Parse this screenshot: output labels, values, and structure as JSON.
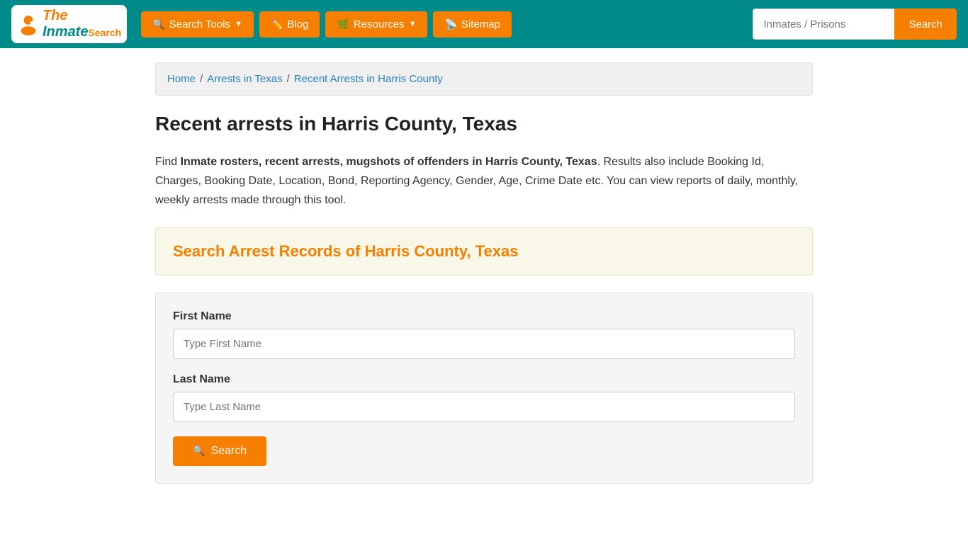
{
  "brand": {
    "name": "The InmateSearch",
    "logo_text_1": "The",
    "logo_text_2": "Inmate",
    "logo_text_3": "Search"
  },
  "navbar": {
    "search_tools_label": "Search Tools",
    "blog_label": "Blog",
    "resources_label": "Resources",
    "sitemap_label": "Sitemap",
    "search_input_placeholder": "Inmates / Prisons",
    "search_button_label": "Search"
  },
  "breadcrumb": {
    "home_label": "Home",
    "sep1": "/",
    "arrests_texas_label": "Arrests in Texas",
    "sep2": "/",
    "current_label": "Recent Arrests in Harris County"
  },
  "page": {
    "title": "Recent arrests in Harris County, Texas",
    "description_1": "Find ",
    "description_bold": "Inmate rosters, recent arrests, mugshots of offenders in Harris County, Texas",
    "description_2": ". Results also include Booking Id, Charges, Booking Date, Location, Bond, Reporting Agency, Gender, Age, Crime Date etc. You can view reports of daily, monthly, weekly arrests made through this tool.",
    "search_section_title": "Search Arrest Records of Harris County, Texas"
  },
  "form": {
    "first_name_label": "First Name",
    "first_name_placeholder": "Type First Name",
    "last_name_label": "Last Name",
    "last_name_placeholder": "Type Last Name",
    "search_button_label": "Search"
  },
  "colors": {
    "teal": "#008b8b",
    "orange": "#f77f00",
    "light_yellow_bg": "#f9f7e8",
    "search_title_color": "#f77f00"
  }
}
